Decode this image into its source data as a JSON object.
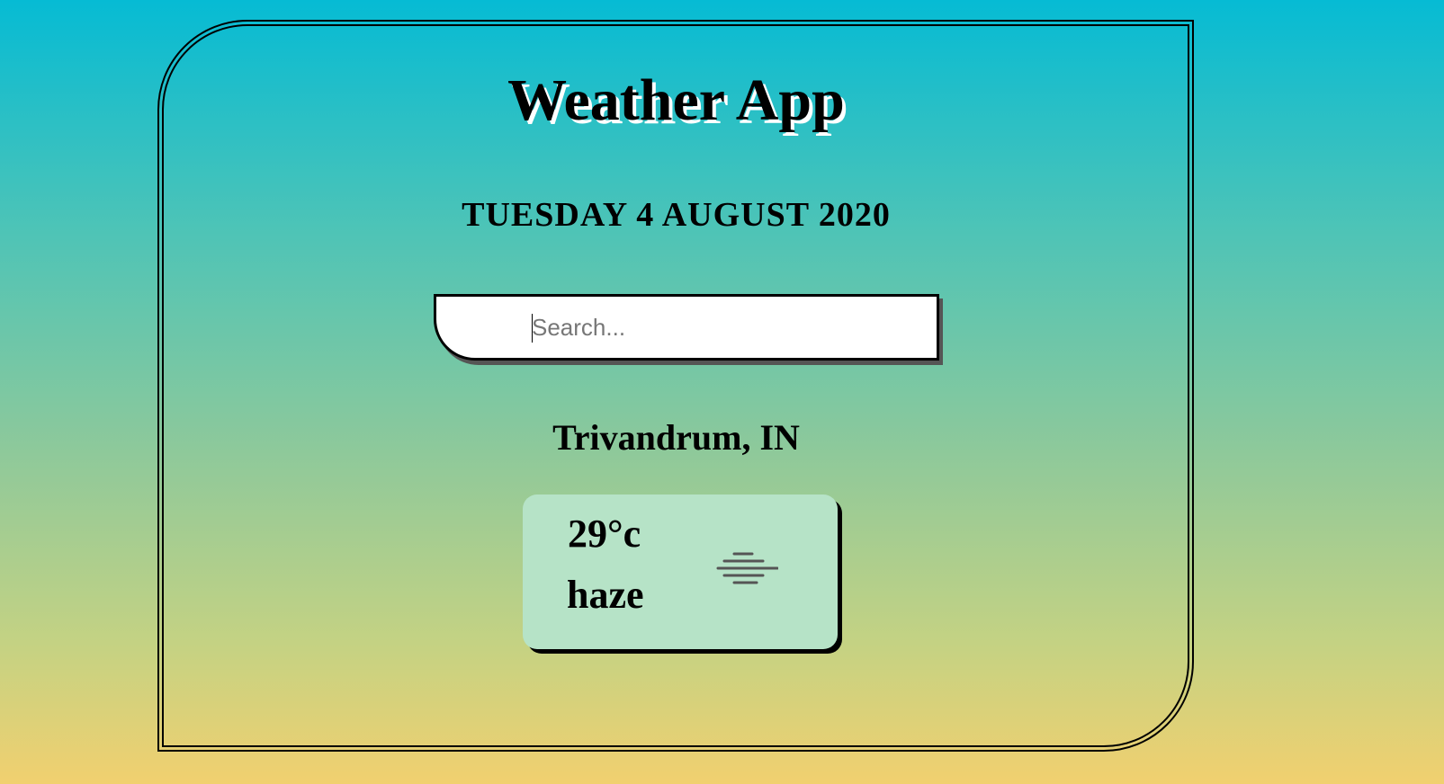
{
  "app": {
    "title": "Weather App"
  },
  "date": "TUESDAY 4 AUGUST 2020",
  "search": {
    "placeholder": "Search...",
    "value": ""
  },
  "location": "Trivandrum, IN",
  "weather": {
    "temperature": "29°c",
    "condition": "haze",
    "icon": "haze-icon"
  },
  "colors": {
    "gradient_top": "#06bbd4",
    "gradient_bottom": "#f1d06f",
    "card_background": "#b6e3c7",
    "title_shadow": "#ffffff"
  }
}
